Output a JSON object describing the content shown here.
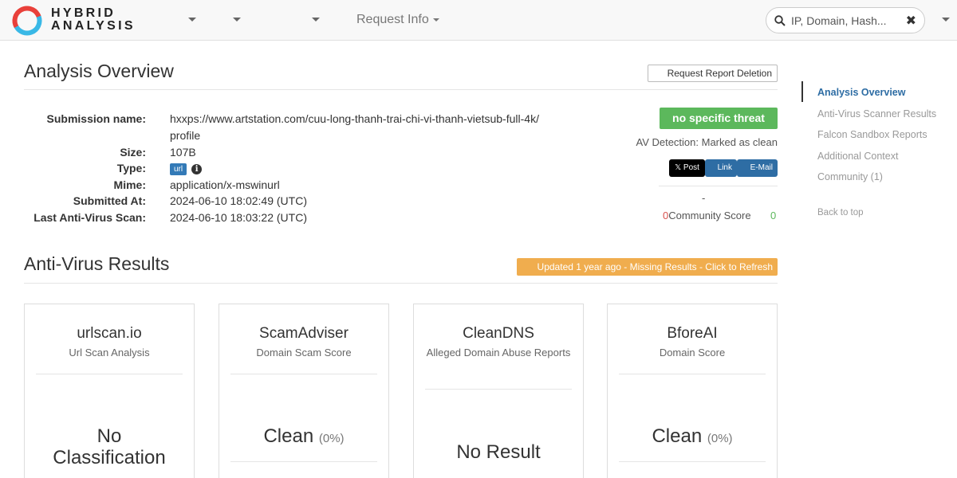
{
  "brand": {
    "line1": "HYBRID",
    "line2": "ANALYSIS"
  },
  "nav": {
    "request_info": "Request Info"
  },
  "search": {
    "placeholder": "IP, Domain, Hash..."
  },
  "overview": {
    "title": "Analysis Overview",
    "delete_button": "Request Report Deletion",
    "labels": {
      "submission_name": "Submission name:",
      "size": "Size:",
      "type": "Type:",
      "mime": "Mime:",
      "submitted_at": "Submitted At:",
      "last_scan": "Last Anti-Virus Scan:"
    },
    "values": {
      "submission_name_1": "hxxps://www.artstation.com/cuu-long-thanh-trai-chi-vi-thanh-vietsub-full-4k/",
      "submission_name_2": "profile",
      "size": "107B",
      "type": "url",
      "mime": "application/x-mswinurl",
      "submitted_at": "2024-06-10 18:02:49 (UTC)",
      "last_scan": "2024-06-10 18:03:22 (UTC)"
    },
    "threat_label": "no specific threat",
    "av_detection": "AV Detection: Marked as clean",
    "share": {
      "x": "Post",
      "link": "Link",
      "email": "E-Mail"
    },
    "community": {
      "dash": "-",
      "left_count": "0",
      "label": "Community Score",
      "right_count": "0"
    }
  },
  "av_results": {
    "title": "Anti-Virus Results",
    "refresh": "Updated 1 year ago - Missing Results - Click to Refresh",
    "cards": [
      {
        "name": "urlscan.io",
        "sub": "Url Scan Analysis",
        "result_1": "No",
        "result_2": "Classification",
        "pct": ""
      },
      {
        "name": "ScamAdviser",
        "sub": "Domain Scam Score",
        "result_1": "Clean",
        "result_2": "",
        "pct": "(0%)"
      },
      {
        "name": "CleanDNS",
        "sub": "Alleged Domain Abuse Reports",
        "result_1": "No Result",
        "result_2": "",
        "pct": ""
      },
      {
        "name": "BforeAI",
        "sub": "Domain Score",
        "result_1": "Clean",
        "result_2": "",
        "pct": "(0%)"
      }
    ]
  },
  "sidenav": {
    "items": [
      "Analysis Overview",
      "Anti-Virus Scanner Results",
      "Falcon Sandbox Reports",
      "Additional Context",
      "Community (1)"
    ],
    "back_to_top": "Back to top"
  },
  "colors": {
    "threat_green": "#5cb85c",
    "refresh_orange": "#f0ad4e",
    "link_blue": "#2e6da4"
  }
}
